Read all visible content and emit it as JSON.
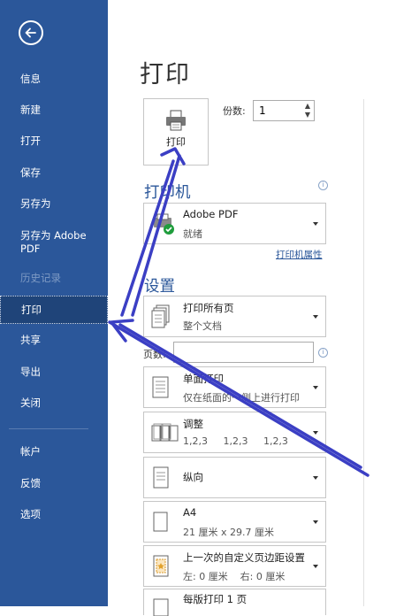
{
  "sidebar": {
    "items": [
      {
        "label": "信息",
        "state": "normal"
      },
      {
        "label": "新建",
        "state": "normal"
      },
      {
        "label": "打开",
        "state": "normal"
      },
      {
        "label": "保存",
        "state": "normal"
      },
      {
        "label": "另存为",
        "state": "normal"
      },
      {
        "label": "另存为 Adobe",
        "label2": "PDF",
        "state": "normal"
      },
      {
        "label": "历史记录",
        "state": "disabled"
      },
      {
        "label": "打印",
        "state": "active"
      },
      {
        "label": "共享",
        "state": "normal"
      },
      {
        "label": "导出",
        "state": "normal"
      },
      {
        "label": "关闭",
        "state": "normal"
      },
      {
        "label": "帐户",
        "state": "normal"
      },
      {
        "label": "反馈",
        "state": "normal"
      },
      {
        "label": "选项",
        "state": "normal"
      }
    ]
  },
  "main": {
    "title": "打印",
    "print_button": {
      "label": "打印",
      "icon": "printer-icon"
    },
    "copies": {
      "label": "份数:",
      "value": "1"
    },
    "printer_section": {
      "title": "打印机",
      "printer": {
        "name": "Adobe PDF",
        "status": "就绪",
        "icon": "printer-ready-icon"
      },
      "properties_link": "打印机属性"
    },
    "settings_section": {
      "title": "设置",
      "pages_label": "页数:",
      "pages_value": "",
      "options": [
        {
          "line1": "打印所有页",
          "line2": "整个文档",
          "icon": "pages-icon"
        },
        {
          "line1": "单面打印",
          "line2": "仅在纸面的一侧上进行打印",
          "icon": "one-sided-icon"
        },
        {
          "line1": "调整",
          "line2": "1,2,3     1,2,3     1,2,3",
          "icon": "collate-icon"
        },
        {
          "line1": "纵向",
          "line2": "",
          "icon": "portrait-icon"
        },
        {
          "line1": "A4",
          "line2": "21 厘米 x 29.7 厘米",
          "icon": "paper-size-icon"
        },
        {
          "line1": "上一次的自定义页边距设置",
          "line2": "左: 0 厘米    右: 0 厘米",
          "icon": "margins-icon"
        },
        {
          "line1": "每版打印 1 页",
          "line2": "",
          "icon": "pages-per-sheet-icon"
        }
      ]
    }
  },
  "colors": {
    "sidebar": "#2b579a",
    "active": "#1f4479",
    "accent": "#2b579a",
    "arrow": "#3b3fc4"
  }
}
